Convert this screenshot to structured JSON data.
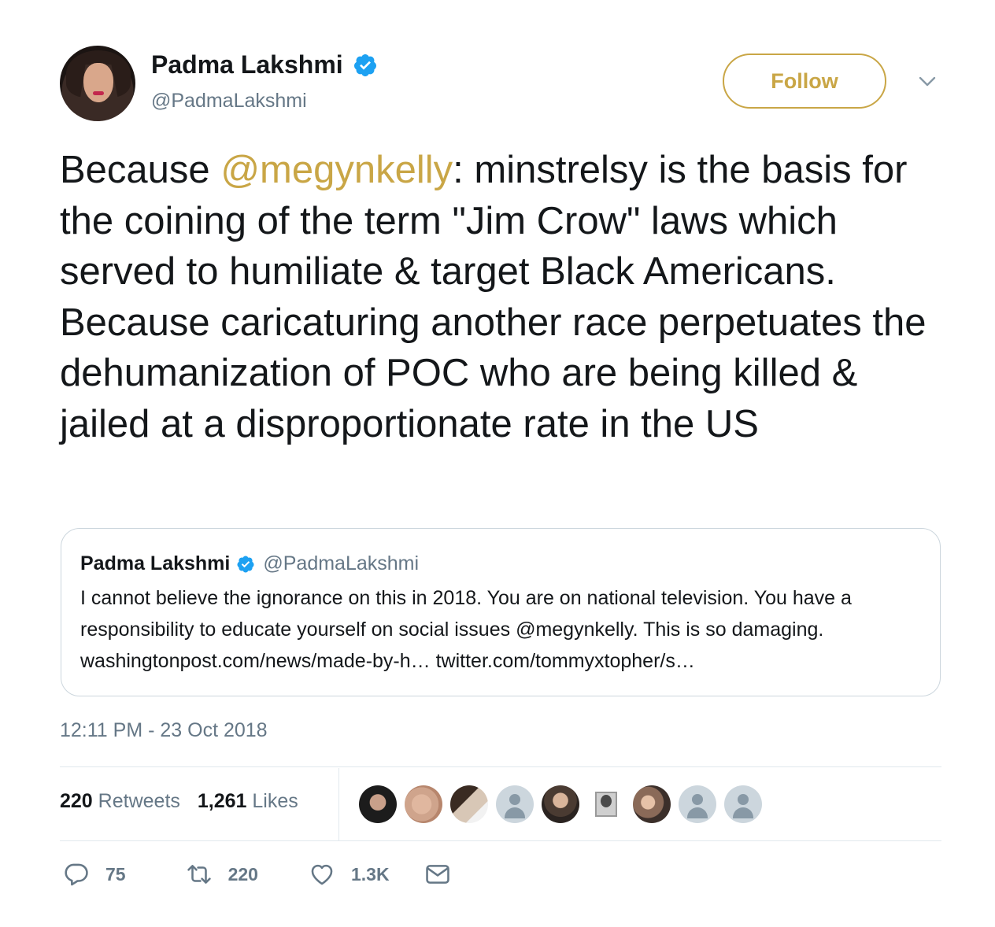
{
  "author": {
    "name": "Padma Lakshmi",
    "handle": "@PadmaLakshmi",
    "avatar_icon": "profile-photo"
  },
  "follow_label": "Follow",
  "accent_color": "#c9a646",
  "tweet": {
    "part1": "Because ",
    "mention": "@megynkelly",
    "part2": ": minstrelsy is the basis for the coining of the term \"Jim Crow\" laws which served to humiliate & target Black Americans. Because caricaturing another race perpetuates the dehumanization of POC who are being killed & jailed at a disproportionate rate in the US"
  },
  "quoted": {
    "name": "Padma Lakshmi",
    "handle": "@PadmaLakshmi",
    "text": "I cannot believe the ignorance on this in 2018. You are on national television. You have a responsibility to educate yourself on social issues @megynkelly.  This is so damaging. washingtonpost.com/news/made-by-h… twitter.com/tommyxtopher/s…"
  },
  "timestamp": "12:11 PM - 23 Oct 2018",
  "stats": {
    "retweets_count": "220",
    "retweets_label": "Retweets",
    "likes_count": "1,261",
    "likes_label": "Likes"
  },
  "actions": {
    "replies": "75",
    "retweets": "220",
    "likes": "1.3K"
  }
}
